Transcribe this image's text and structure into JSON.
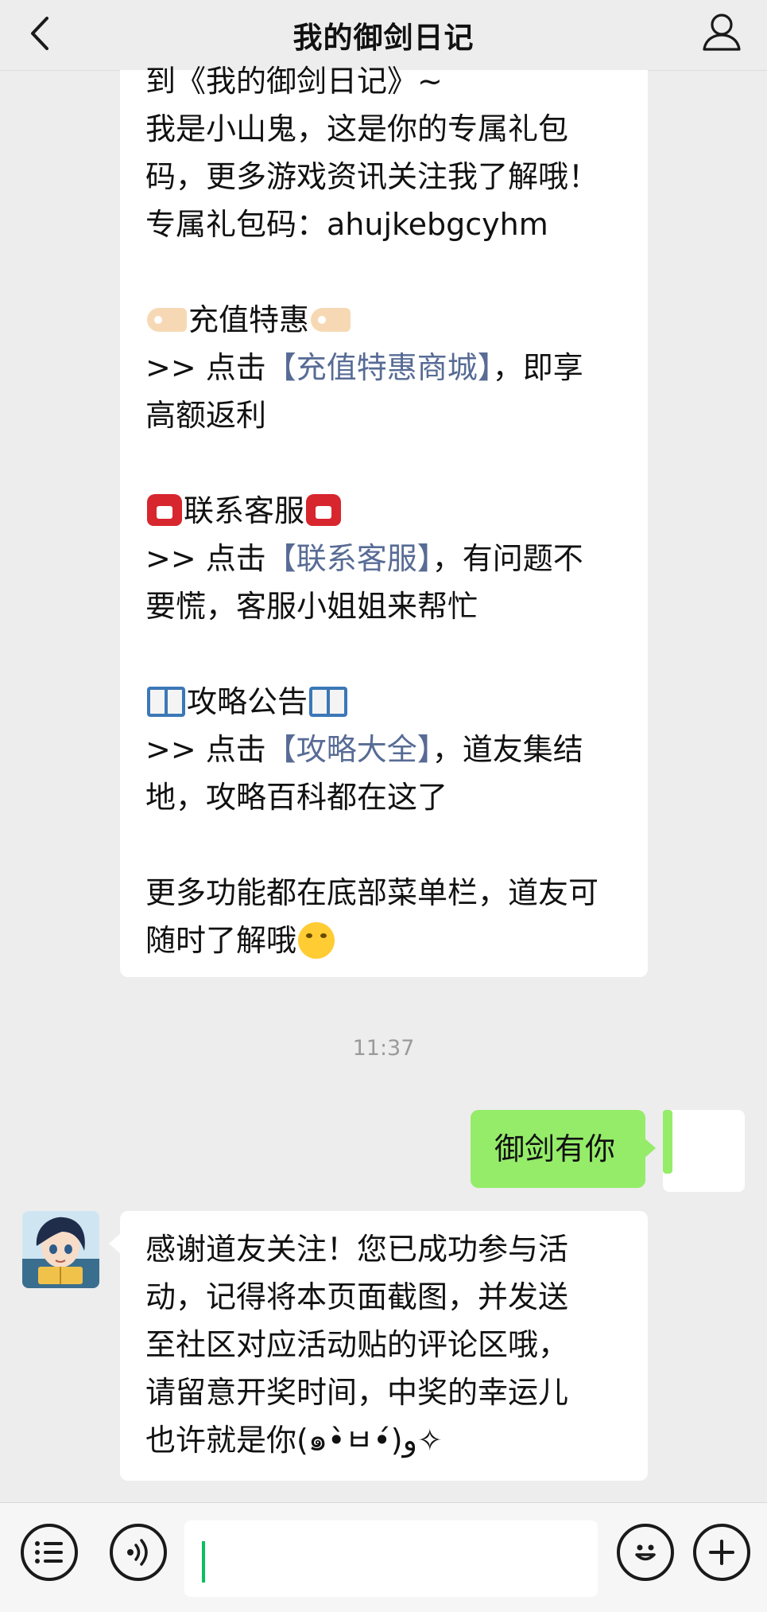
{
  "header": {
    "title": "我的御剑日记",
    "back_icon": "chevron-left-icon",
    "profile_icon": "person-icon"
  },
  "messages": {
    "first": {
      "cutoff_line": "到《我的御剑日记》~",
      "intro_line1": "我是小山鬼，这是你的专属礼包",
      "intro_line2": "码，更多游戏资讯关注我了解哦！",
      "code_line": "专属礼包码：ahujkebgcyhm",
      "recharge_heading": "充值特惠",
      "recharge_prefix": ">> 点击",
      "recharge_link": "【充值特惠商城】",
      "recharge_suffix": "，即享",
      "recharge_line2": "高额返利",
      "service_heading": "联系客服",
      "service_prefix": ">> 点击",
      "service_link": "【联系客服】",
      "service_suffix": "，有问题不",
      "service_line2": "要慌，客服小姐姐来帮忙",
      "guide_heading": "攻略公告",
      "guide_prefix": ">> 点击",
      "guide_link": "【攻略大全】",
      "guide_suffix": "，道友集结",
      "guide_line2": "地，攻略百科都在这了",
      "more_line1": "更多功能都在底部菜单栏，道友可",
      "more_line2": "随时了解哦"
    },
    "timestamp": "11:37",
    "user_reply": "御剑有你",
    "bot_reply": {
      "line1": "感谢道友关注！您已成功参与活",
      "line2": "动，记得将本页面截图，并发送",
      "line3": "至社区对应活动贴的评论区哦，",
      "line4": "请留意开奖时间，中奖的幸运儿",
      "line5": "也许就是你(๑•̀ㅂ•́)و✧"
    }
  },
  "bottom_bar": {
    "menu_icon": "list-menu-icon",
    "voice_icon": "voice-icon",
    "emoji_icon": "smiley-icon",
    "plus_icon": "plus-icon",
    "input_value": ""
  },
  "colors": {
    "background": "#ededed",
    "bubble_self": "#95ec69",
    "bubble_other": "#ffffff",
    "link": "#576b95",
    "caret": "#07c160"
  }
}
